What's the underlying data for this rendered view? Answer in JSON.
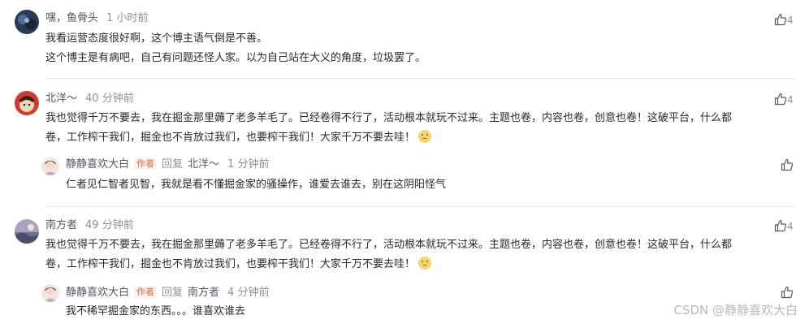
{
  "comments": [
    {
      "user": "嘿，鱼骨头",
      "time": "1 小时前",
      "likes": "4",
      "lines": [
        "我看运营态度很好啊，这个博主语气倒是不善。",
        "这个博主是有病吧，自己有问题还怪人家。以为自己站在大义的角度，垃圾罢了。"
      ]
    },
    {
      "user": "北洋～",
      "time": "40 分钟前",
      "likes": "4",
      "lines": [
        "我也觉得千万不要去，我在掘金那里薅了老多羊毛了。已经卷得不行了，活动根本就玩不过来。主题也卷，内容也卷，创意也卷！这破平台，什么都",
        "卷，工作榨干我们，掘金也不肯放过我们，也要榨干我们！大家千万不要去哇！"
      ],
      "reply": {
        "user": "静静喜欢大白",
        "badge": "作者",
        "reply_word": "回复",
        "target": "北洋～",
        "time": "1 分钟前",
        "text": "仁者见仁智者见智，我就是看不懂掘金家的骚操作，谁爱去谁去，别在这阴阳怪气"
      }
    },
    {
      "user": "南方者",
      "time": "49 分钟前",
      "likes": "4",
      "lines": [
        "我也觉得千万不要去，我在掘金那里薅了老多羊毛了。已经卷得不行了，活动根本就玩不过来。主题也卷，内容也卷，创意也卷！这破平台，什么都",
        "卷，工作榨干我们，掘金也不肯放过我们，也要榨干我们！大家千万不要去哇！"
      ],
      "reply": {
        "user": "静静喜欢大白",
        "badge": "作者",
        "reply_word": "回复",
        "target": "南方者",
        "time": "4 分钟前",
        "text": "我不稀罕掘金家的东西。。。谁喜欢谁去"
      }
    }
  ],
  "watermark": "CSDN @静静喜欢大白",
  "icons": {
    "like": "thumb-up-icon",
    "emoji": "annoyed-face-emoji"
  },
  "colors": {
    "author_badge": "#f2633c",
    "name": "#515767",
    "meta": "#8a919f",
    "text": "#252933"
  }
}
